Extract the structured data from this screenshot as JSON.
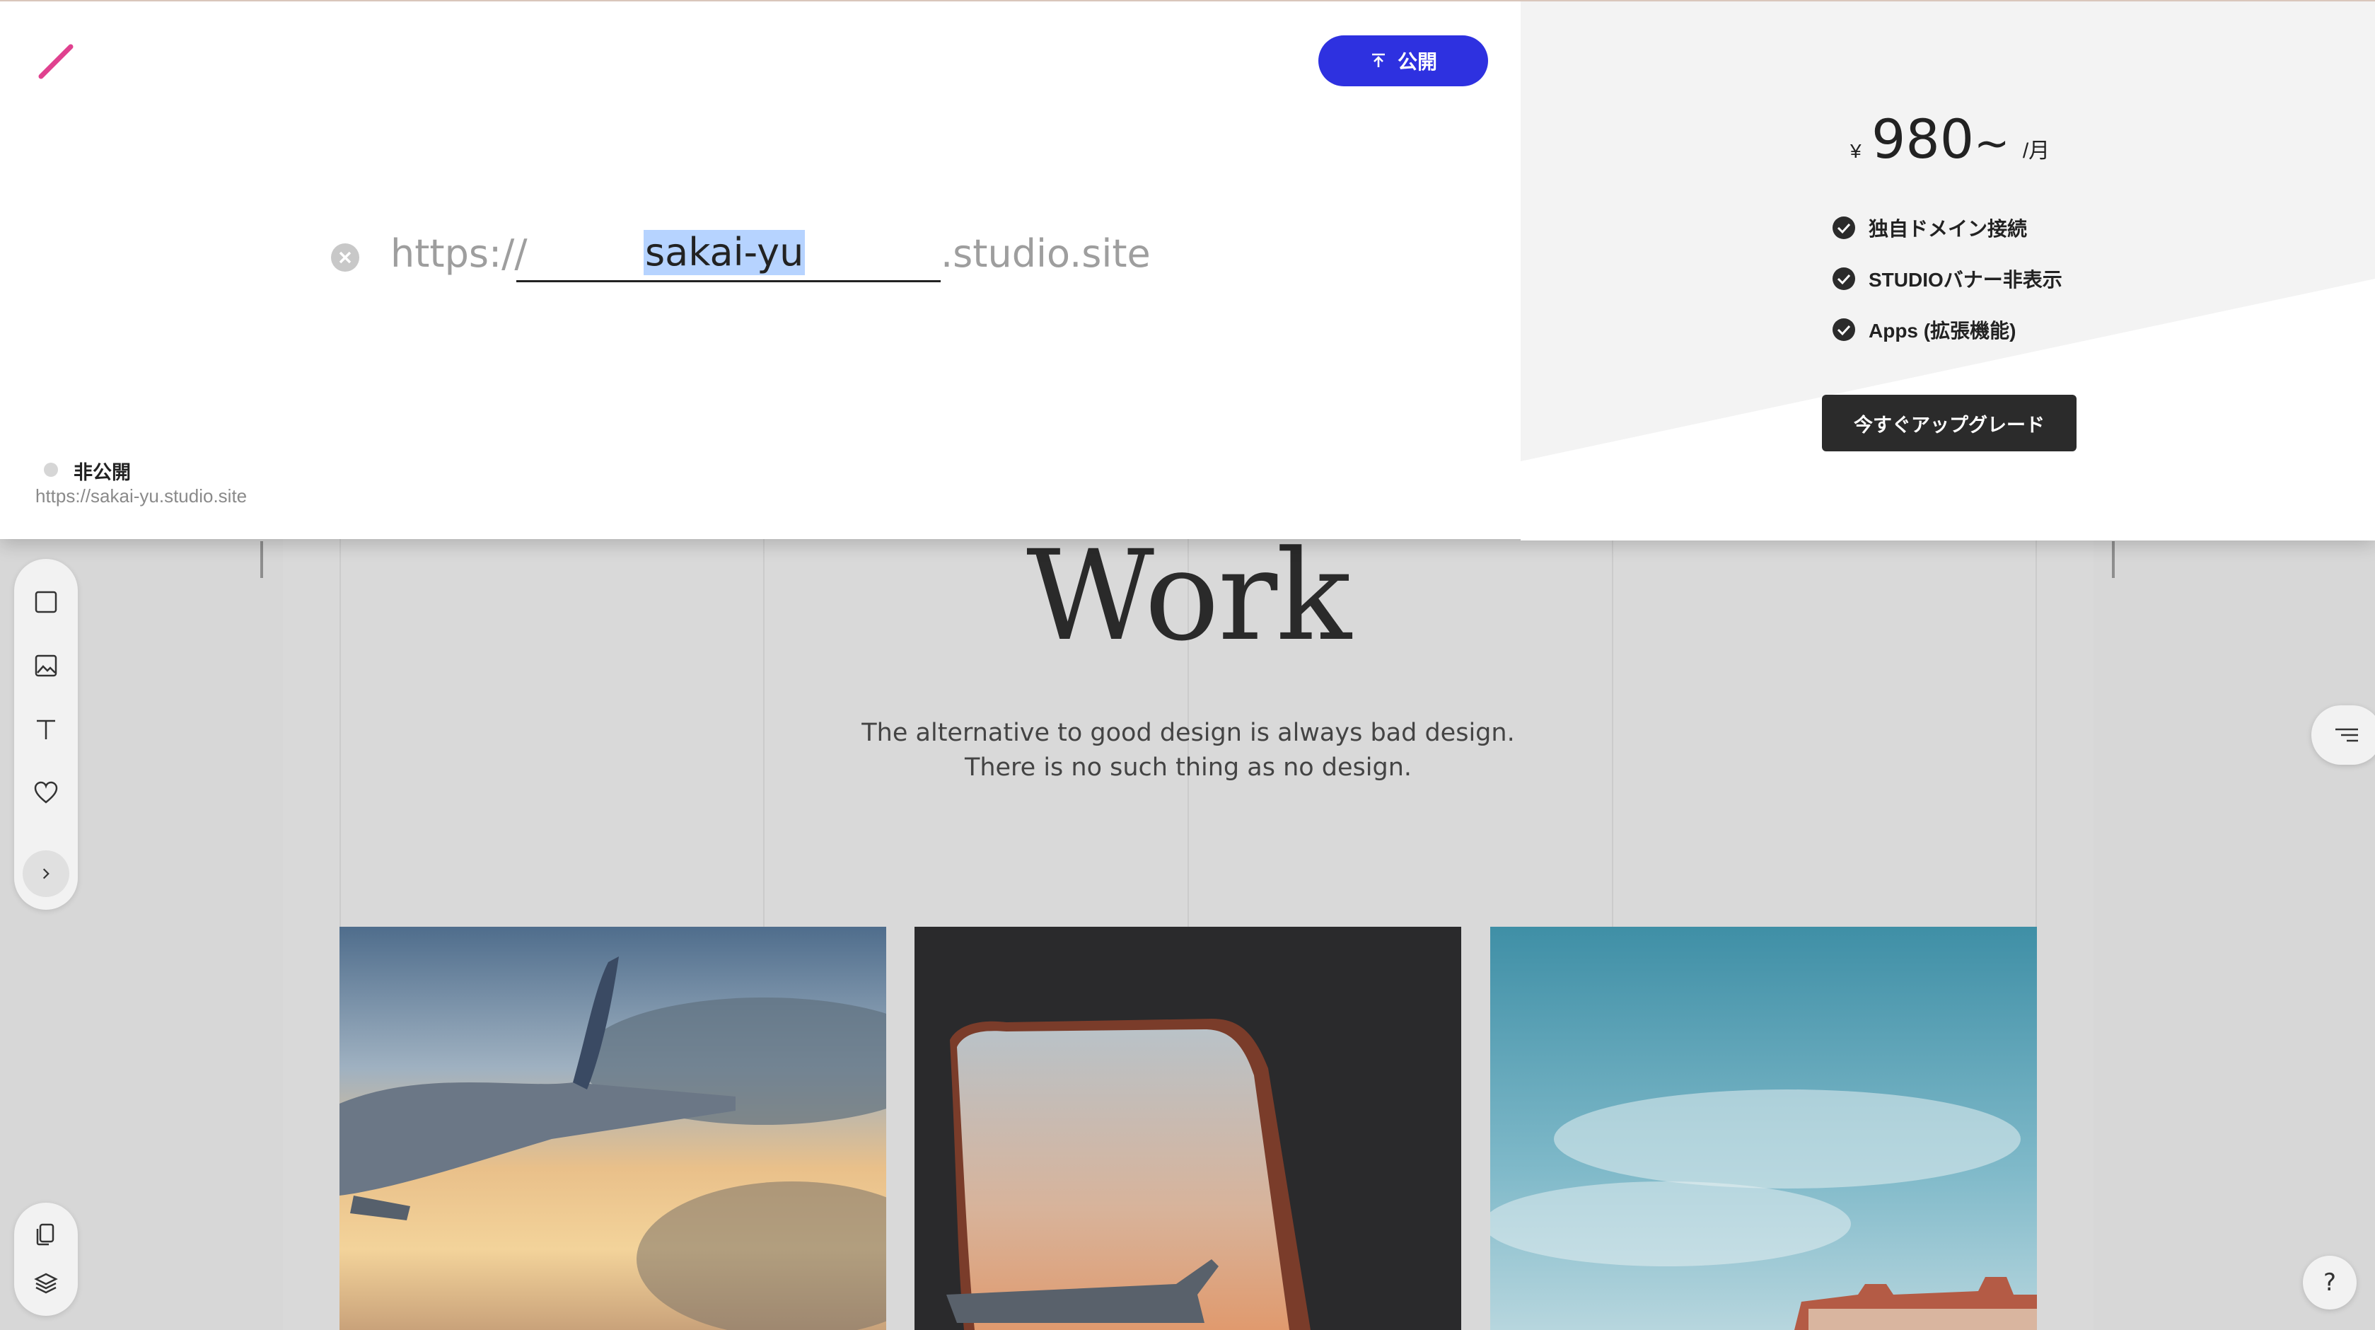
{
  "publish": {
    "button_label": "公開",
    "url": {
      "prefix": "https://",
      "subdomain": "sakai-yu",
      "suffix": ".studio.site"
    },
    "status": {
      "label": "非公開",
      "url": "https://sakai-yu.studio.site"
    }
  },
  "pricing": {
    "currency": "¥",
    "amount": "980",
    "tilde": "~",
    "unit": "/月",
    "features": [
      "独自ドメイン接続",
      "STUDIOバナー非表示",
      "Apps (拡張機能)"
    ],
    "upgrade_label": "今すぐアップグレード"
  },
  "canvas": {
    "title": "Work",
    "description_lines": [
      "The alternative to good design is always bad design.",
      "There is no such thing as no design."
    ]
  },
  "help": {
    "label": "?"
  },
  "colors": {
    "publish_button": "#2e31e0",
    "upgrade_button": "#2b2b2b",
    "logo_stroke": "#e0418f",
    "url_highlight": "#b6d3ff"
  },
  "icons": {
    "logo": "slash-logo-icon",
    "publish": "upload-arrow-icon",
    "clear": "clear-circle-icon",
    "check": "check-circle-icon",
    "toolbar": [
      "box-icon",
      "image-icon",
      "text-icon",
      "heart-icon",
      "chevron-right-icon",
      "pages-icon",
      "layers-icon",
      "panel-lines-icon"
    ]
  }
}
